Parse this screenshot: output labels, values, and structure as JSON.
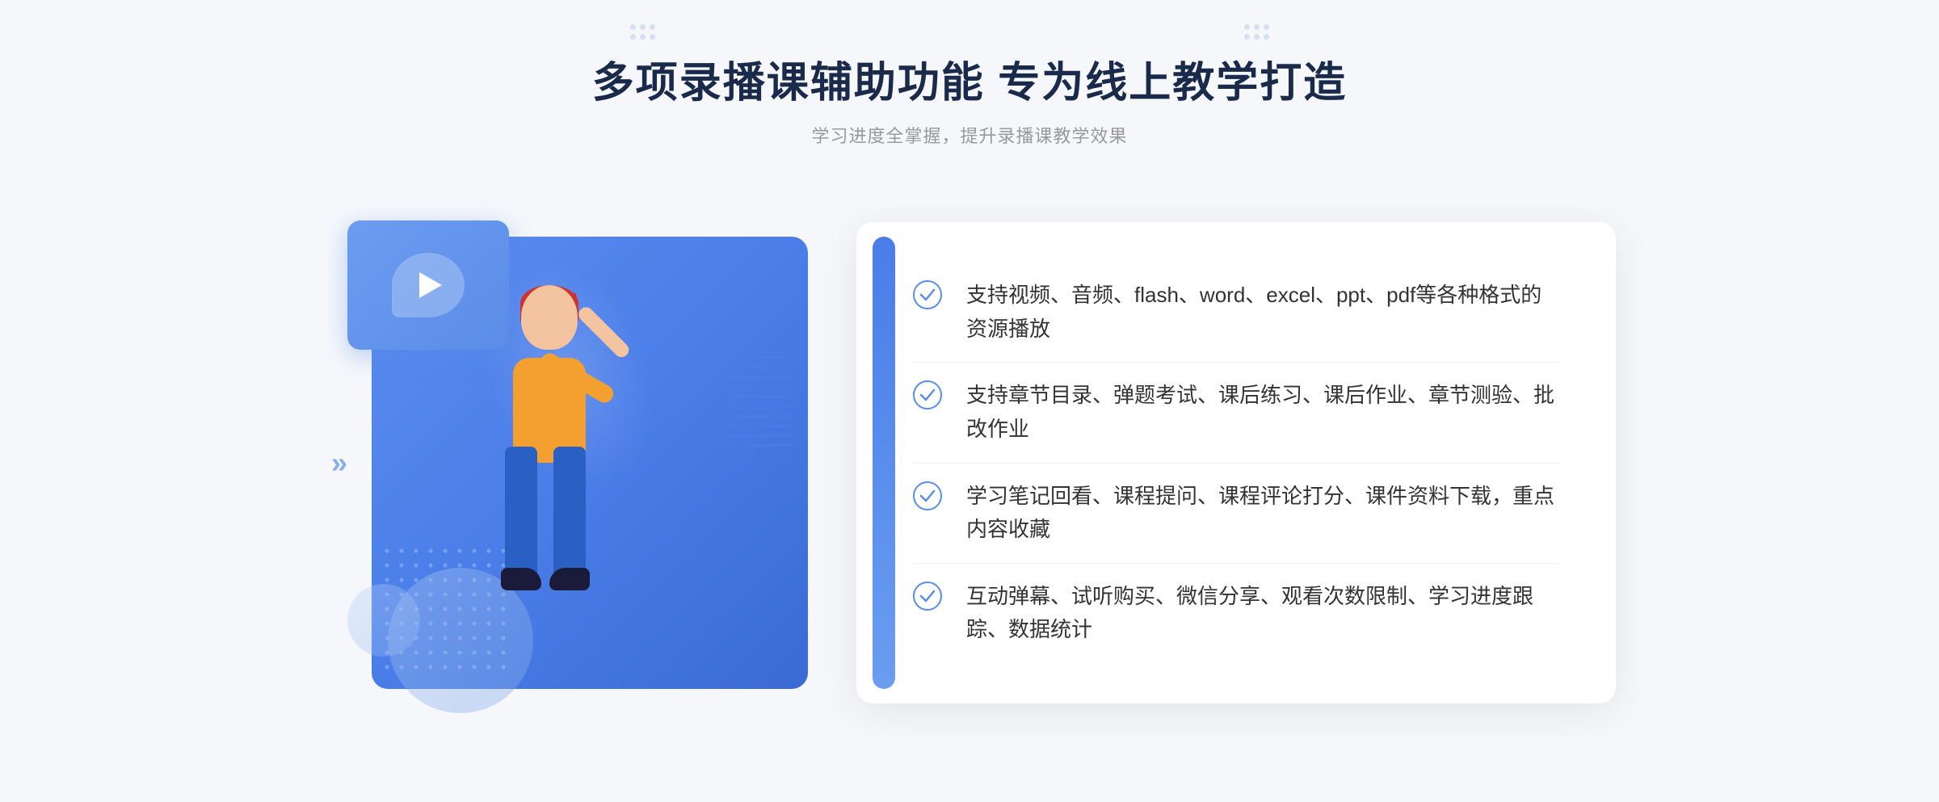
{
  "header": {
    "title": "多项录播课辅助功能 专为线上教学打造",
    "subtitle": "学习进度全掌握，提升录播课教学效果",
    "decoration_left": "⁝⁝",
    "decoration_right": "⁝⁝"
  },
  "features": [
    {
      "id": 1,
      "text": "支持视频、音频、flash、word、excel、ppt、pdf等各种格式的资源播放"
    },
    {
      "id": 2,
      "text": "支持章节目录、弹题考试、课后练习、课后作业、章节测验、批改作业"
    },
    {
      "id": 3,
      "text": "学习笔记回看、课程提问、课程评论打分、课件资料下载，重点内容收藏"
    },
    {
      "id": 4,
      "text": "互动弹幕、试听购买、微信分享、观看次数限制、学习进度跟踪、数据统计"
    }
  ],
  "colors": {
    "primary_blue": "#4a7de8",
    "light_blue": "#6b9cf0",
    "dark_title": "#1a2a4a",
    "text_gray": "#999999",
    "feature_text": "#333333",
    "check_color": "#5a8de8"
  }
}
